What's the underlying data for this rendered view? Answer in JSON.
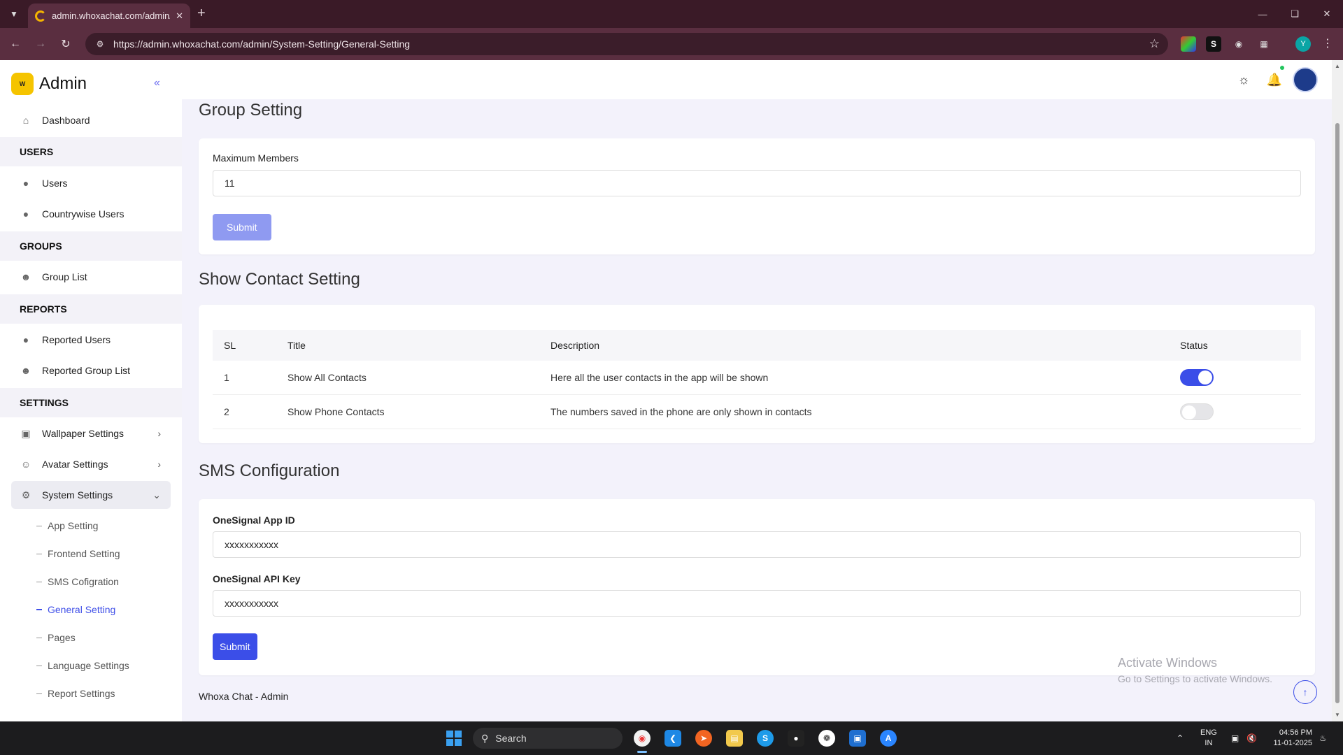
{
  "browser": {
    "tab_title": "admin.whoxachat.com/admin/S",
    "url": "https://admin.whoxachat.com/admin/System-Setting/General-Setting",
    "profile_initial": "Y"
  },
  "sidebar": {
    "brand": "Admin",
    "logo_text": "W",
    "dashboard": "Dashboard",
    "sections": {
      "users": "USERS",
      "groups": "GROUPS",
      "reports": "REPORTS",
      "settings": "SETTINGS"
    },
    "users_items": [
      "Users",
      "Countrywise Users"
    ],
    "groups_items": [
      "Group List"
    ],
    "reports_items": [
      "Reported Users",
      "Reported Group List"
    ],
    "settings_items": [
      "Wallpaper Settings",
      "Avatar Settings",
      "System Settings"
    ],
    "system_sub_items": [
      "App Setting",
      "Frontend Setting",
      "SMS Cofigration",
      "General Setting",
      "Pages",
      "Language Settings",
      "Report Settings"
    ]
  },
  "group_setting": {
    "heading": "Group Setting",
    "label": "Maximum Members",
    "value": "11",
    "submit": "Submit"
  },
  "contact_setting": {
    "heading": "Show Contact Setting",
    "columns": [
      "SL",
      "Title",
      "Description",
      "Status"
    ],
    "rows": [
      {
        "sl": "1",
        "title": "Show All Contacts",
        "description": "Here all the user contacts in the app will be shown",
        "status": true
      },
      {
        "sl": "2",
        "title": "Show Phone Contacts",
        "description": "The numbers saved in the phone are only shown in contacts",
        "status": false
      }
    ]
  },
  "sms_config": {
    "heading": "SMS Configuration",
    "app_id_label": "OneSignal App ID",
    "app_id_value": "xxxxxxxxxxx",
    "api_key_label": "OneSignal API Key",
    "api_key_value": "xxxxxxxxxxx",
    "submit": "Submit"
  },
  "footer": "Whoxa Chat - Admin",
  "watermark": {
    "title": "Activate Windows",
    "subtitle": "Go to Settings to activate Windows."
  },
  "colors": {
    "accent": "#3b4ee8",
    "accent_light": "#8f9af1",
    "browser_frame": "#5a2e40",
    "page_bg": "#f3f2fb"
  },
  "taskbar": {
    "search_placeholder": "Search",
    "lang_line1": "ENG",
    "lang_line2": "IN",
    "time": "04:56 PM",
    "date": "11-01-2025"
  }
}
